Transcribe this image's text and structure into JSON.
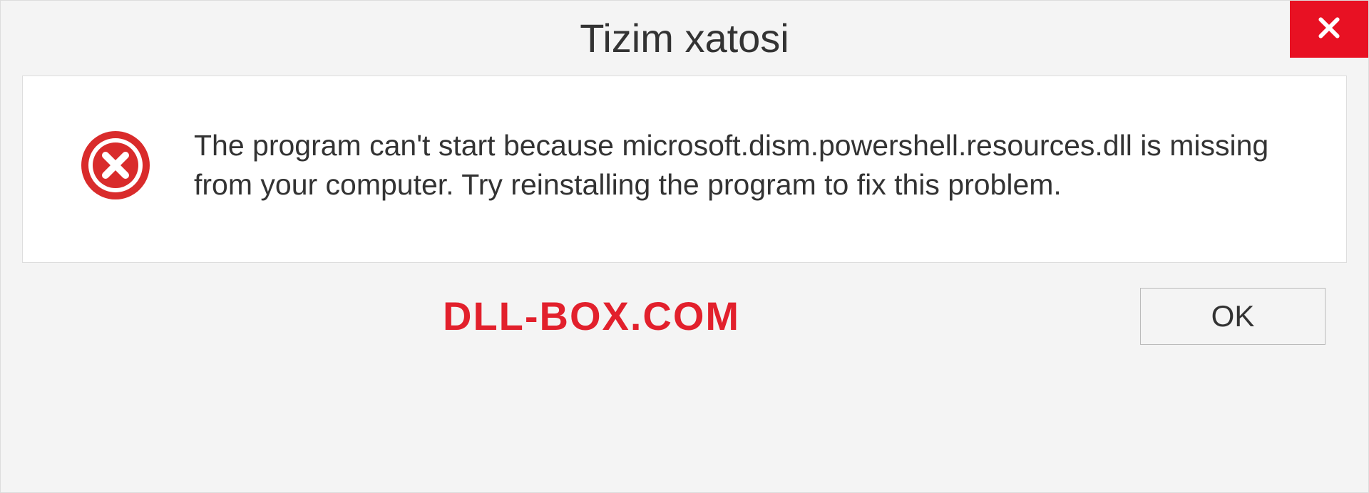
{
  "dialog": {
    "title": "Tizim xatosi",
    "message": "The program can't start because microsoft.dism.powershell.resources.dll is missing from your computer. Try reinstalling the program to fix this problem.",
    "ok_label": "OK"
  },
  "watermark": "DLL-BOX.COM",
  "colors": {
    "close_red": "#e81123",
    "error_red": "#d92b2b",
    "watermark_red": "#e2202c"
  }
}
